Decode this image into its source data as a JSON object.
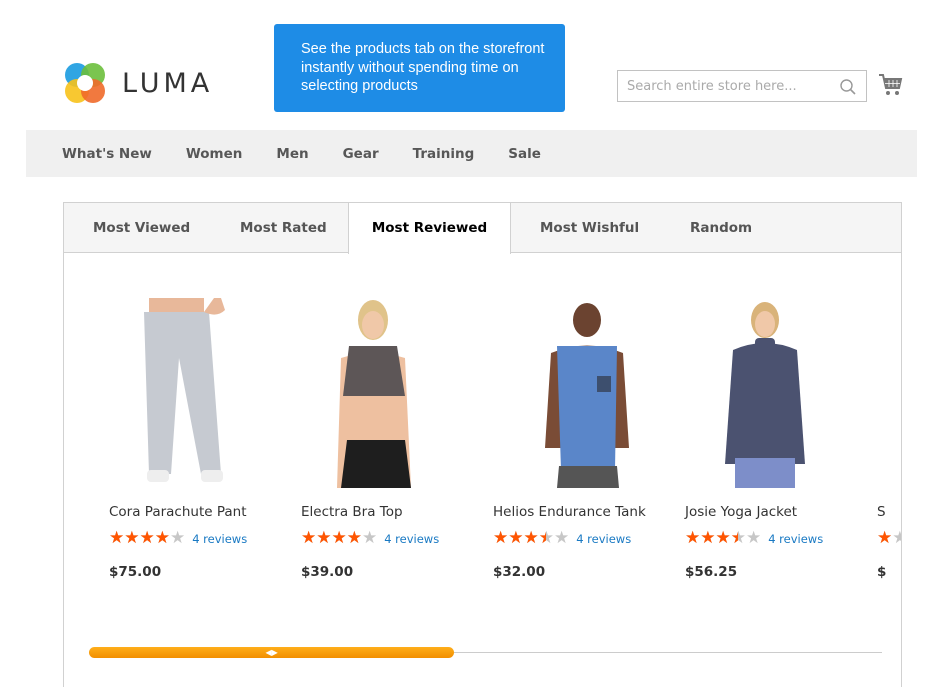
{
  "header": {
    "logo_text": "LUMA",
    "promo_text": "See the products tab on the storefront instantly without spending time on selecting products",
    "search": {
      "placeholder": "Search entire store here...",
      "value": ""
    },
    "icons": {
      "search": "search-icon",
      "cart": "cart-icon"
    }
  },
  "nav": {
    "items": [
      {
        "label": "What's New"
      },
      {
        "label": "Women"
      },
      {
        "label": "Men"
      },
      {
        "label": "Gear"
      },
      {
        "label": "Training"
      },
      {
        "label": "Sale"
      }
    ]
  },
  "tabs": {
    "items": [
      {
        "label": "Most Viewed",
        "active": false
      },
      {
        "label": "Most Rated",
        "active": false
      },
      {
        "label": "Most Reviewed",
        "active": true
      },
      {
        "label": "Most Wishful",
        "active": false
      },
      {
        "label": "Random",
        "active": false
      }
    ]
  },
  "products": [
    {
      "name": "Cora Parachute Pant",
      "rating_stars": 4,
      "rating_max": 5,
      "reviews": "4 reviews",
      "price": "$75.00"
    },
    {
      "name": "Electra Bra Top",
      "rating_stars": 4,
      "rating_max": 5,
      "reviews": "4 reviews",
      "price": "$39.00"
    },
    {
      "name": "Helios Endurance Tank",
      "rating_stars": 3.5,
      "rating_max": 5,
      "reviews": "4 reviews",
      "price": "$32.00"
    },
    {
      "name": "Josie Yoga Jacket",
      "rating_stars": 3.5,
      "rating_max": 5,
      "reviews": "4 reviews",
      "price": "$56.25"
    },
    {
      "name": "S",
      "rating_stars": 1,
      "rating_max": 5,
      "reviews": "",
      "price": "$"
    }
  ],
  "carousel": {
    "scroll_position_fraction": 0.0,
    "visible_fraction": 0.46
  },
  "colors": {
    "promo_bg": "#1e8ce6",
    "star_filled": "#ff5501",
    "star_empty": "#c7c7c7",
    "review_link": "#1979c3",
    "scroll_thumb": "#ffa00a",
    "nav_bg": "#f0f0f0"
  }
}
